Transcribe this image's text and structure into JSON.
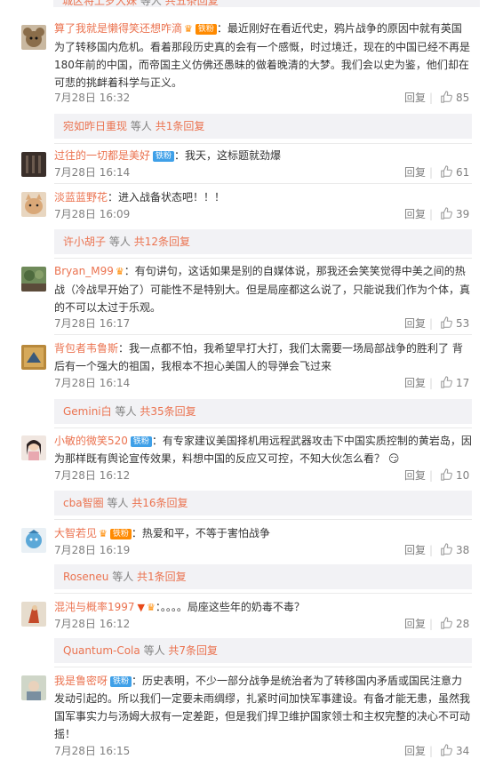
{
  "top_strip": {
    "user": "城区将上岁大妹",
    "others": "等人",
    "count": "共五条回复"
  },
  "reply_label": "回复",
  "comments": [
    {
      "name": "算了我就是懒得笑还想咋滴",
      "badge": "铁粉",
      "text": "：最近刚好在看近代史，鸦片战争的原因中就有英国为了转移国内危机。看着那段历史真的会有一个感慨，时过境迁，现在的中国已经不再是180年前的中国，而帝国主义仿佛还愚昧的做着晚清的大梦。我们会以史为鉴，他们却在可悲的挑衅着科学与正义。",
      "date": "7月28日 16:32",
      "likes": "85",
      "sub_reply": {
        "user": "宛如昨日重现",
        "others": "等人",
        "count": "共1条回复"
      }
    },
    {
      "name": "过往的一切都是美好",
      "badge": "铁粉",
      "text": "：我天，这标题就劲爆",
      "date": "7月28日 16:14",
      "likes": "61"
    },
    {
      "name": "淡蓝蓝野花",
      "text": "：进入战备状态吧！！！",
      "date": "7月28日 16:09",
      "likes": "39",
      "sub_reply": {
        "user": "许小胡子",
        "others": "等人",
        "count": "共12条回复"
      }
    },
    {
      "name": "Bryan_M99",
      "text": "：有句讲句，这话如果是别的自媒体说，那我还会笑笑觉得中美之间的热战（冷战早开始了）可能性不是特别大。但是局座都这么说了，只能说我们作为个体，真的不可以太过于乐观。",
      "date": "7月28日 16:17",
      "likes": "53"
    },
    {
      "name": "背包者韦鲁斯",
      "text": "：我一点都不怕，我希望早打大打，我们太需要一场局部战争的胜利了 背后有一个强大的祖国，我根本不担心美国人的导弹会飞过来",
      "date": "7月28日 16:14",
      "likes": "17",
      "sub_reply": {
        "user": "Gemini白",
        "others": "等人",
        "count": "共35条回复"
      }
    },
    {
      "name": "小敏的微笑520",
      "badge": "铁粉",
      "text": "：有专家建议美国择机用远程武器攻击下中国实质控制的黄岩岛，因为那样既有舆论宣传效果，料想中国的反应又可控，不知大伙怎么看？",
      "date": "7月28日 16:12",
      "likes": "10",
      "sub_reply": {
        "user": "cba智圈",
        "others": "等人",
        "count": "共16条回复"
      }
    },
    {
      "name": "大智若见",
      "badge": "铁粉",
      "text": "：热爱和平，不等于害怕战争",
      "date": "7月28日 16:19",
      "likes": "38",
      "sub_reply": {
        "user": "Roseneu",
        "others": "等人",
        "count": "共1条回复"
      }
    },
    {
      "name": "混沌与概率1997",
      "text": "：。。。。局座这些年的奶毒不毒？",
      "date": "7月28日 16:12",
      "likes": "28",
      "sub_reply": {
        "user": "Quantum-Cola",
        "others": "等人",
        "count": "共7条回复"
      }
    },
    {
      "name": "我是鲁密呀",
      "badge": "铁粉",
      "text": "：历史表明，不少一部分战争是统治者为了转移国内矛盾或国民注意力发动引起的。所以我们一定要未雨绸缪，扎紧时间加快军事建设。有备才能无患，虽然我国军事实力与汤姆大叔有一定差距，但是我们捍卫维护国家领士和主权完整的决心不可动摇！",
      "date": "7月28日 16:15",
      "likes": "34"
    }
  ],
  "colors": {
    "link": "#eb7350",
    "meta": "#808080",
    "bar_bg": "#f2f2f5",
    "badge_blue": "#3fa0e8"
  }
}
